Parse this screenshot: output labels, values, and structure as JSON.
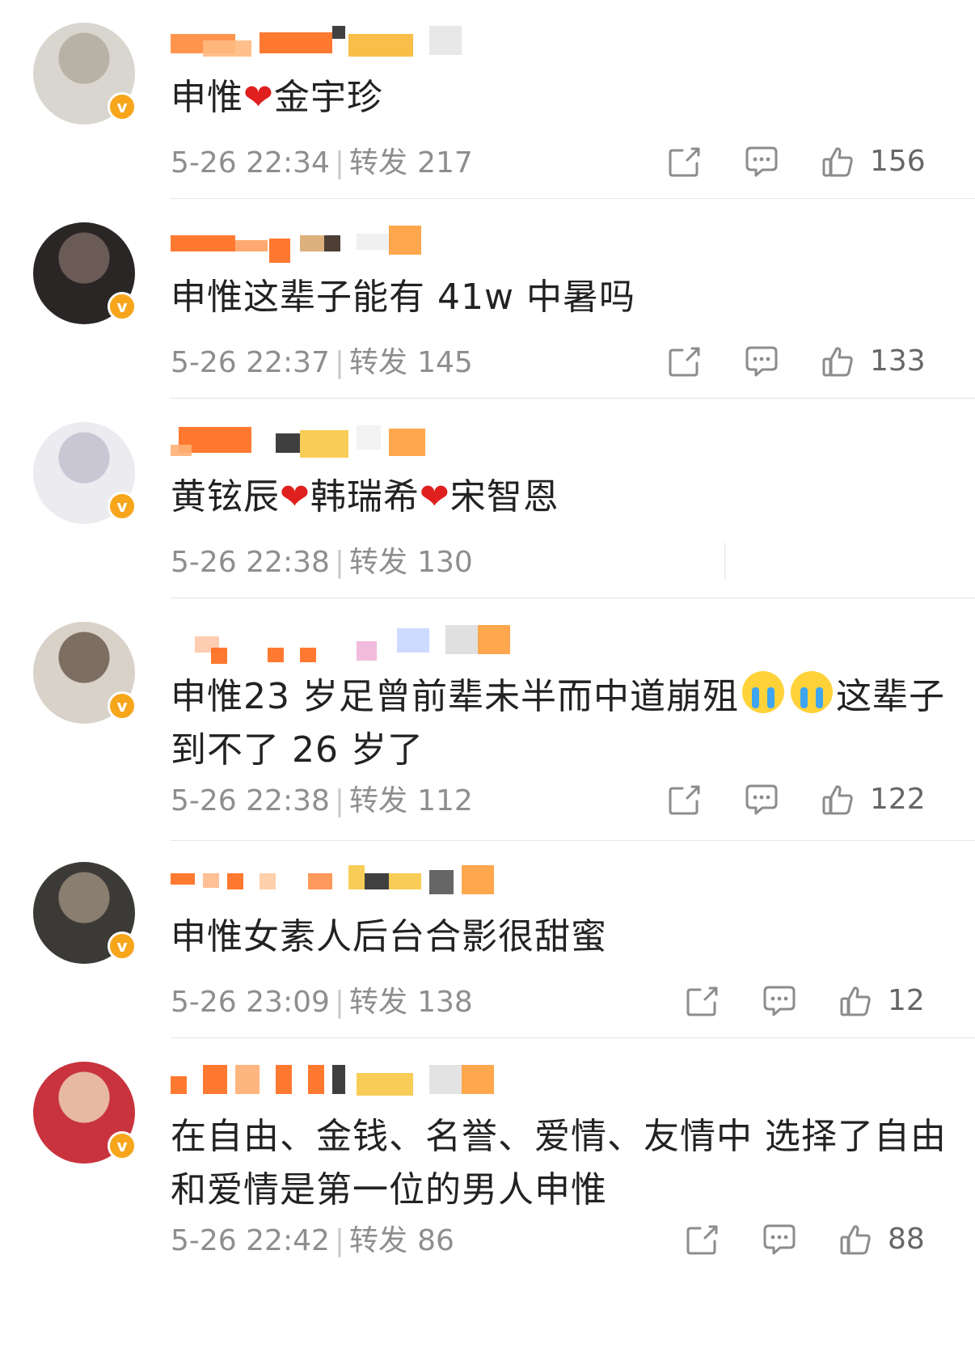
{
  "comments": [
    {
      "content": "申惟❤️金宇珍",
      "parts": [
        "申惟",
        "heart",
        "金宇珍"
      ],
      "time": "5-26 22:34",
      "repost_label": "转发",
      "reposts": "217",
      "likes": "156",
      "show_actions": true
    },
    {
      "content": "申惟这辈子能有 41w 中暑吗",
      "parts": [
        "申惟这辈子能有 41w 中暑吗"
      ],
      "time": "5-26 22:37",
      "repost_label": "转发",
      "reposts": "145",
      "likes": "133",
      "show_actions": true
    },
    {
      "content": "黄铉辰❤️韩瑞希❤️宋智恩",
      "parts": [
        "黄铉辰",
        "heart",
        "韩瑞希",
        "heart",
        "宋智恩"
      ],
      "time": "5-26 22:38",
      "repost_label": "转发",
      "reposts": "130",
      "likes": "",
      "show_actions": false
    },
    {
      "content": "申惟23 岁足曾前辈未半而中道崩殂😭😭这辈子到不了 26 岁了",
      "parts": [
        "申惟23 岁足曾前辈未半而中道崩殂",
        "cry",
        "cry",
        "这辈子到不了 26 岁了"
      ],
      "time": "5-26 22:38",
      "repost_label": "转发",
      "reposts": "112",
      "likes": "122",
      "show_actions": true
    },
    {
      "content": "申惟女素人后台合影很甜蜜",
      "parts": [
        "申惟女素人后台合影很甜蜜"
      ],
      "time": "5-26 23:09",
      "repost_label": "转发",
      "reposts": "138",
      "likes": "12",
      "show_actions": true
    },
    {
      "content": "在自由、金钱、名誉、爱情、友情中 选择了自由和爱情是第一位的男人申惟",
      "parts": [
        "在自由、金钱、名誉、爱情、友情中 选择了自由和爱情是第一位的男人申惟"
      ],
      "time": "5-26 22:42",
      "repost_label": "转发",
      "reposts": "86",
      "likes": "88",
      "show_actions": true
    }
  ],
  "icons": {
    "share": "share-icon",
    "comment": "comment-icon",
    "like": "thumbs-up-icon",
    "verified": "verified-badge-icon"
  },
  "colors": {
    "badge": "#f7a51b",
    "heart": "#e0201f",
    "meta": "#8e8e8e",
    "text": "#222222"
  }
}
